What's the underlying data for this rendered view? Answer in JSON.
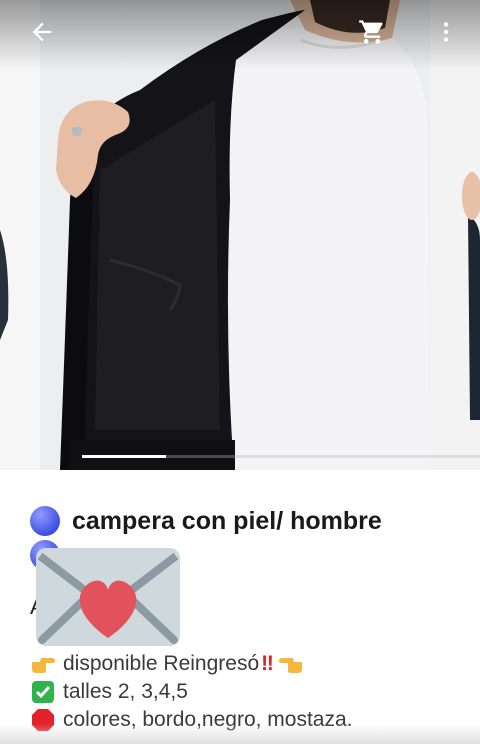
{
  "product": {
    "title": "campera con piel/ hombre",
    "partial_letter": "A",
    "lines": [
      {
        "before": "disponible Reingresó",
        "after": ""
      },
      {
        "text": "talles 2, 3,4,5"
      },
      {
        "text": "colores, bordo,negro, mostaza."
      }
    ]
  },
  "icons": {
    "back": "arrow-left-icon",
    "cart": "shopping-cart-icon",
    "more": "more-vert-icon"
  },
  "colors": {
    "accent_blue": "#3f4fe0"
  }
}
